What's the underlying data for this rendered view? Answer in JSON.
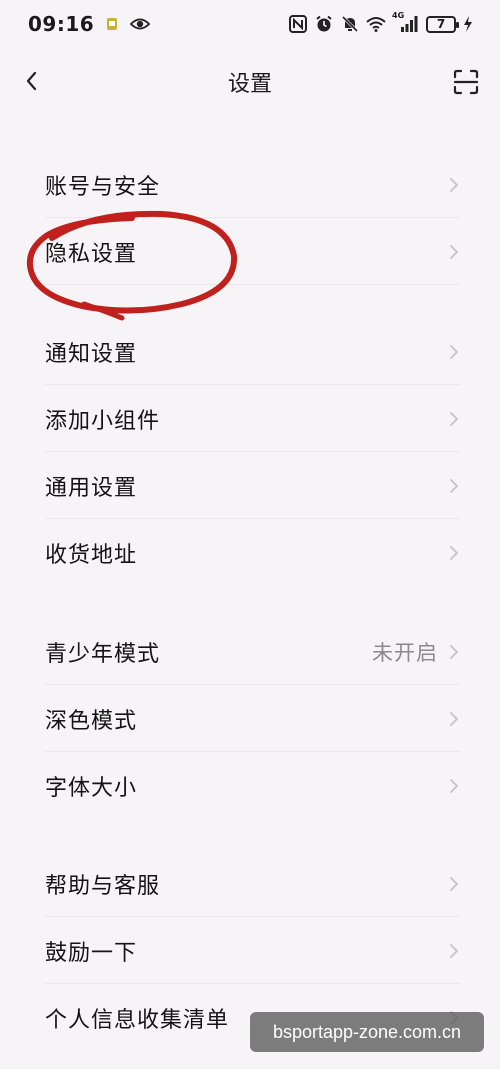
{
  "status_bar": {
    "time": "09:16",
    "network": "4G",
    "battery": "7"
  },
  "header": {
    "title": "设置"
  },
  "groups": [
    {
      "items": [
        {
          "label": "账号与安全"
        },
        {
          "label": "隐私设置"
        },
        {
          "label": "通知设置"
        },
        {
          "label": "添加小组件"
        },
        {
          "label": "通用设置"
        },
        {
          "label": "收货地址"
        }
      ]
    },
    {
      "items": [
        {
          "label": "青少年模式",
          "value": "未开启"
        },
        {
          "label": "深色模式"
        },
        {
          "label": "字体大小"
        }
      ]
    },
    {
      "items": [
        {
          "label": "帮助与客服"
        },
        {
          "label": "鼓励一下"
        },
        {
          "label": "个人信息收集清单"
        }
      ]
    }
  ],
  "watermark": {
    "text": "bsportapp-zone.com.cn"
  },
  "colors": {
    "background": "#f6f4f6",
    "annotation": "#c1211c",
    "secondary_text": "#8a8a8a"
  }
}
